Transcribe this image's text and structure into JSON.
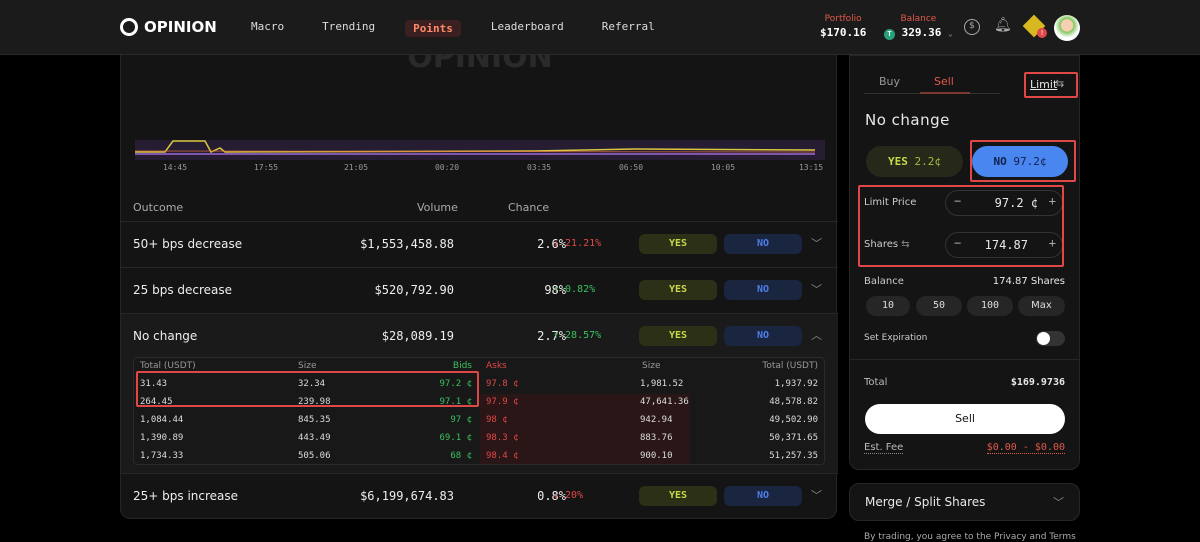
{
  "nav": {
    "logo": "OPINION",
    "links": [
      "Macro",
      "Trending",
      "Points",
      "Leaderboard",
      "Referral"
    ],
    "portfolio_label": "Portfolio",
    "portfolio_value": "$170.16",
    "balance_label": "Balance",
    "balance_value": "329.36",
    "badge": "!"
  },
  "chart": {
    "watermark": "OPINION",
    "x_ticks": [
      "14:45",
      "17:55",
      "21:05",
      "00:20",
      "03:35",
      "06:50",
      "10:05",
      "13:15"
    ]
  },
  "table": {
    "headers": {
      "outcome": "Outcome",
      "volume": "Volume",
      "chance": "Chance"
    },
    "yes": "YES",
    "no": "NO",
    "rows": [
      {
        "name": "50+ bps decrease",
        "volume": "$1,553,458.88",
        "chance": "2.6%",
        "delta": "↓ 21.21%",
        "dir": "down"
      },
      {
        "name": "25 bps decrease",
        "volume": "$520,792.90",
        "chance": "98%",
        "delta": "↑ 0.82%",
        "dir": "up"
      },
      {
        "name": "No change",
        "volume": "$28,089.19",
        "chance": "2.7%",
        "delta": "↑ 28.57%",
        "dir": "up"
      },
      {
        "name": "25+ bps increase",
        "volume": "$6,199,674.83",
        "chance": "0.8%",
        "delta": "↓ 20%",
        "dir": "down"
      }
    ]
  },
  "orderbook": {
    "headers": [
      "Total (USDT)",
      "Size",
      "Bids",
      "Asks",
      "Size",
      "Total (USDT)"
    ],
    "rows": [
      [
        "31.43",
        "32.34",
        "97.2 ¢",
        "97.8 ¢",
        "1,981.52",
        "1,937.92"
      ],
      [
        "264.45",
        "239.98",
        "97.1 ¢",
        "97.9 ¢",
        "47,641.36",
        "48,578.82"
      ],
      [
        "1,084.44",
        "845.35",
        "97 ¢",
        "98 ¢",
        "942.94",
        "49,502.90"
      ],
      [
        "1,390.89",
        "443.49",
        "69.1 ¢",
        "98.3 ¢",
        "883.76",
        "50,371.65"
      ],
      [
        "1,734.33",
        "505.06",
        "68 ¢",
        "98.4 ¢",
        "900.10",
        "51,257.35"
      ]
    ]
  },
  "trade": {
    "buy": "Buy",
    "sell": "Sell",
    "order_type": "Limit",
    "outcome": "No change",
    "yes_label": "YES",
    "yes_price": "2.2¢",
    "no_label": "NO",
    "no_price": "97.2¢",
    "limit_price_label": "Limit Price",
    "limit_price": "97.2 ¢",
    "shares_label": "Shares",
    "shares": "174.87",
    "balance_label": "Balance",
    "balance_value": "174.87 Shares",
    "quick": [
      "10",
      "50",
      "100",
      "Max"
    ],
    "expiration_label": "Set Expiration",
    "total_label": "Total",
    "total_value": "$169.9736",
    "submit": "Sell",
    "fee_label": "Est. Fee",
    "fee_value": "$0.00 - $0.00"
  },
  "merge": {
    "label": "Merge / Split Shares",
    "terms": "By trading, you agree to the Privacy and Terms"
  }
}
